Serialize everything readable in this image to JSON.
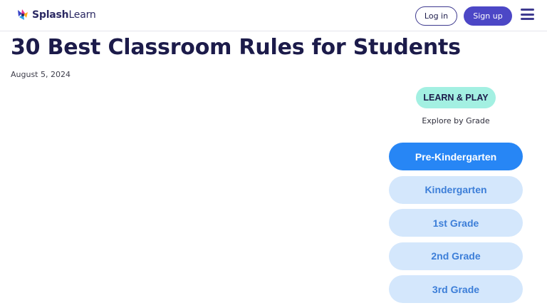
{
  "header": {
    "logo_text_bold": "Splash",
    "logo_text_light": "Learn",
    "login_label": "Log in",
    "signup_label": "Sign up"
  },
  "article": {
    "title": "30 Best Classroom Rules for Students",
    "date": "August 5, 2024"
  },
  "sidebar": {
    "badge": "LEARN & PLAY",
    "explore_label": "Explore by Grade",
    "grades": [
      {
        "label": "Pre-Kindergarten",
        "active": true
      },
      {
        "label": "Kindergarten",
        "active": false
      },
      {
        "label": "1st Grade",
        "active": false
      },
      {
        "label": "2nd Grade",
        "active": false
      },
      {
        "label": "3rd Grade",
        "active": false
      }
    ]
  },
  "colors": {
    "brand_purple": "#4c47c6",
    "navy": "#1c1b4a",
    "teal_badge": "#a3f0e2",
    "grade_active": "#2786f5",
    "grade_inactive_bg": "#d4e7fc",
    "grade_inactive_text": "#3c7ed8"
  },
  "icons": [
    "splashlearn-logo-icon",
    "hamburger-menu-icon"
  ]
}
